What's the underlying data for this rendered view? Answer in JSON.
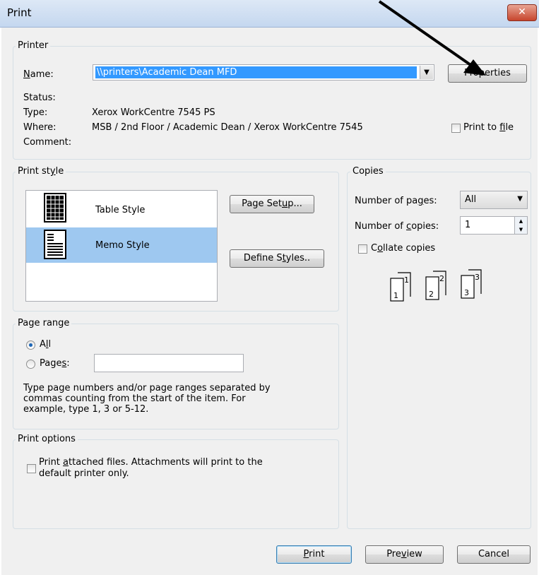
{
  "window": {
    "title": "Print",
    "close_icon": "close-x-icon"
  },
  "printer": {
    "group_label": "Printer",
    "name_label": "Name:",
    "name_value": "\\\\printers\\Academic Dean MFD",
    "properties_button": "Properties",
    "status_label": "Status:",
    "status_value": "",
    "type_label": "Type:",
    "type_value": "Xerox WorkCentre 7545 PS",
    "where_label": "Where:",
    "where_value": "MSB / 2nd Floor / Academic Dean / Xerox WorkCentre 7545",
    "comment_label": "Comment:",
    "comment_value": "",
    "print_to_file_label": "Print to file"
  },
  "print_style": {
    "group_label": "Print style",
    "styles": [
      {
        "name": "Table Style",
        "icon": "table-style-icon",
        "selected": false
      },
      {
        "name": "Memo Style",
        "icon": "memo-style-icon",
        "selected": true
      }
    ],
    "page_setup_button": "Page Setup...",
    "define_styles_button": "Define Styles.."
  },
  "copies": {
    "group_label": "Copies",
    "pages_label": "Number of pages:",
    "pages_value": "All",
    "copies_label": "Number of copies:",
    "copies_value": "1",
    "collate_label": "Collate copies",
    "collate_pages": [
      "1",
      "1",
      "2",
      "2",
      "3",
      "3"
    ]
  },
  "page_range": {
    "group_label": "Page range",
    "all_label": "All",
    "pages_label": "Pages:",
    "pages_value": "",
    "help_text_1": "Type page numbers and/or page ranges separated by",
    "help_text_2": "commas counting from the start of the item.  For",
    "help_text_3": "example, type 1, 3 or 5-12."
  },
  "print_options": {
    "group_label": "Print options",
    "attached_line_1": "Print attached files.  Attachments will print to the",
    "attached_line_2": "default printer only."
  },
  "footer": {
    "print_button": "Print",
    "preview_button": "Preview",
    "cancel_button": "Cancel"
  },
  "colors": {
    "selection": "#9ec8f0",
    "arrow": "#000000",
    "titlebar": "#c4d7ef"
  }
}
